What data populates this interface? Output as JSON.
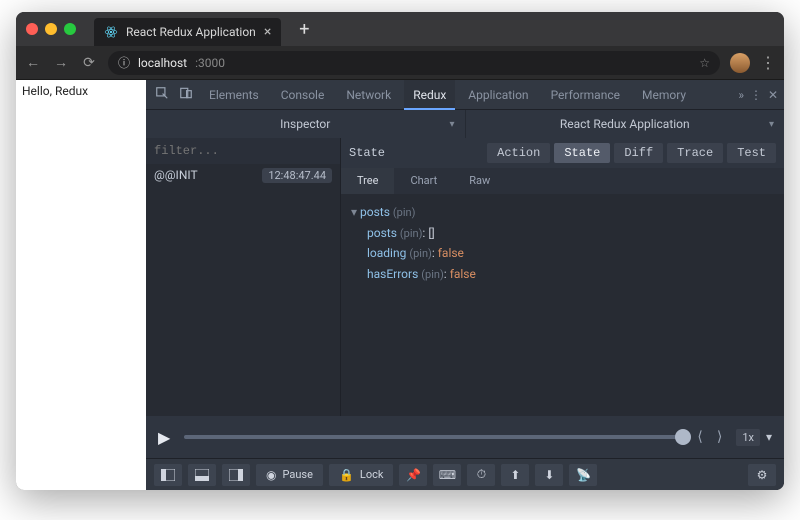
{
  "browser": {
    "tab_title": "React Redux Application",
    "url_host": "localhost",
    "url_port": ":3000",
    "new_tab_glyph": "+",
    "info_glyph": "ⓘ"
  },
  "page": {
    "content": "Hello, Redux"
  },
  "devtools": {
    "tabs": [
      "Elements",
      "Console",
      "Network",
      "Redux",
      "Application",
      "Performance",
      "Memory"
    ],
    "active_tab_index": 3,
    "more_glyph": "»",
    "menu_glyph": "⋮",
    "close_glyph": "✕"
  },
  "redux": {
    "selector_left": "Inspector",
    "selector_right": "React Redux Application",
    "filter_placeholder": "filter...",
    "actions": [
      {
        "name": "@@INIT",
        "ts": "12:48:47.44"
      }
    ],
    "state_label": "State",
    "view_buttons": [
      "Action",
      "State",
      "Diff",
      "Trace",
      "Test"
    ],
    "view_active_index": 1,
    "subtabs": [
      "Tree",
      "Chart",
      "Raw"
    ],
    "subtab_active_index": 0,
    "tree": {
      "root_key": "posts",
      "pin": "(pin)",
      "children": [
        {
          "key": "posts",
          "pin": "(pin)",
          "val_box": "[]"
        },
        {
          "key": "loading",
          "pin": "(pin)",
          "val": "false"
        },
        {
          "key": "hasErrors",
          "pin": "(pin)",
          "val": "false"
        }
      ]
    },
    "speed": "1x",
    "toolbar": {
      "pause": "Pause",
      "lock": "Lock"
    }
  }
}
